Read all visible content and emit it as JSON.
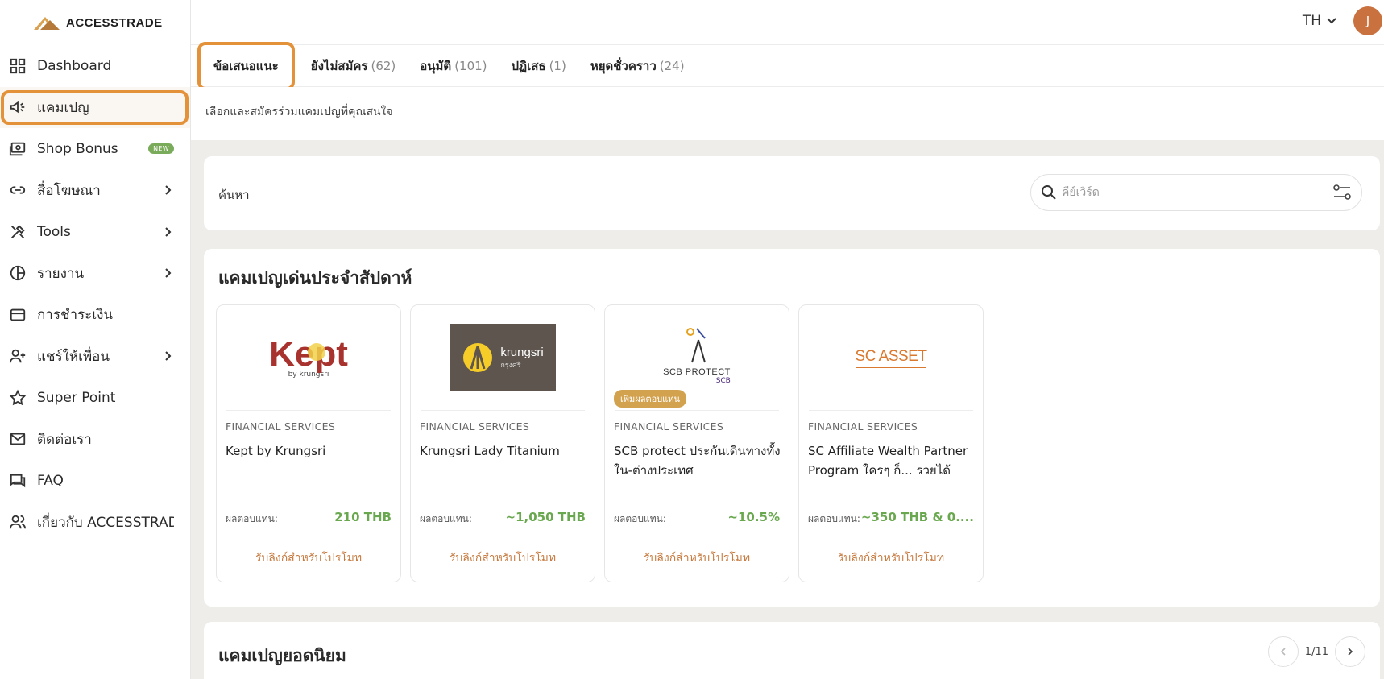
{
  "app": {
    "logo_text": "ACCESSTRADE",
    "lang": "TH",
    "avatar_initial": "J",
    "brand_color": "#e3923a"
  },
  "sidebar": {
    "items": [
      {
        "label": "Dashboard",
        "icon": "dashboard-icon"
      },
      {
        "label": "แคมเปญ",
        "icon": "megaphone-icon"
      },
      {
        "label": "Shop Bonus",
        "icon": "shop-bonus-icon",
        "badge": "NEW"
      },
      {
        "label": "สื่อโฆษณา",
        "icon": "link-icon"
      },
      {
        "label": "Tools",
        "icon": "tools-icon"
      },
      {
        "label": "รายงาน",
        "icon": "pie-chart-icon"
      },
      {
        "label": "การชำระเงิน",
        "icon": "credit-card-icon"
      },
      {
        "label": "แชร์ให้เพื่อน",
        "icon": "add-user-icon"
      },
      {
        "label": "Super Point",
        "icon": "star-icon"
      },
      {
        "label": "ติดต่อเรา",
        "icon": "mail-icon"
      },
      {
        "label": "FAQ",
        "icon": "chat-icon"
      },
      {
        "label": "เกี่ยวกับ ACCESSTRAD",
        "icon": "users-icon"
      }
    ]
  },
  "tabs": [
    {
      "label": "ข้อเสนอแนะ",
      "count": ""
    },
    {
      "label": "ยังไม่สมัคร",
      "count": "(62)"
    },
    {
      "label": "อนุมัติ",
      "count": "(101)"
    },
    {
      "label": "ปฏิเสธ",
      "count": "(1)"
    },
    {
      "label": "หยุดชั่วคราว",
      "count": "(24)"
    }
  ],
  "subhead": "เลือกและสมัครร่วมแคมเปญที่คุณสนใจ",
  "search": {
    "label": "ค้นหา",
    "placeholder": "คีย์เวิร์ด"
  },
  "featured": {
    "title": "แคมเปญเด่นประจำสัปดาห์",
    "cards": [
      {
        "category": "FINANCIAL SERVICES",
        "name": "Kept by Krungsri",
        "reward_label": "ผลตอบแทน:",
        "reward": "210 THB",
        "link": "รับลิงก์สำหรับโปรโมท",
        "logo": {
          "main": "Kept",
          "sub": "by krungsri"
        }
      },
      {
        "category": "FINANCIAL SERVICES",
        "name": "Krungsri Lady Titanium",
        "reward_label": "ผลตอบแทน:",
        "reward": "~1,050 THB",
        "link": "รับลิงก์สำหรับโปรโมท",
        "logo": {
          "main": "krungsri",
          "sub": "กรุงศรี"
        }
      },
      {
        "category": "FINANCIAL SERVICES",
        "name": "SCB protect ประกันเดินทางทั้งใน-ต่างประเทศ",
        "reward_label": "ผลตอบแทน:",
        "reward": "~10.5%",
        "link": "รับลิงก์สำหรับโปรโมท",
        "logo": {
          "main": "SCB PROTECT",
          "sub": "SCB"
        },
        "badge": "เพิ่มผลตอบแทน"
      },
      {
        "category": "FINANCIAL SERVICES",
        "name": "SC Affiliate Wealth Partner Program ใครๆ ก็... รวยได้",
        "reward_label": "ผลตอบแทน:",
        "reward": "~350 THB & 0....",
        "link": "รับลิงก์สำหรับโปรโมท",
        "logo": {
          "main": "SC ASSET"
        }
      }
    ]
  },
  "popular": {
    "title": "แคมเปญยอดนิยม",
    "page": "1/11"
  }
}
